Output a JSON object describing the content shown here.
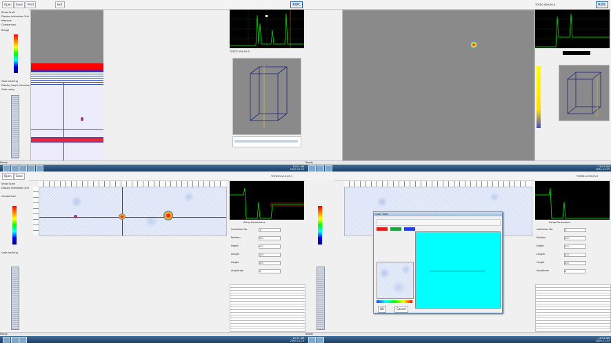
{
  "brand": "KDC",
  "toolbar": {
    "btn1": "Open",
    "btn2": "Save",
    "btn3": "Print",
    "btn4": "Exit"
  },
  "panels": {
    "q1_id": "TOFD7-V09-09-5",
    "q2_id": "TOFD7-V09-09-5",
    "q3_id": "TOFD11-V10-09-1",
    "q4_id": "TOFD13-V09-09-3"
  },
  "left_controls": {
    "cb1": "Show Scale",
    "cb2": "Display Indication Grid",
    "cb3": "Measure",
    "cb4": "Comparison",
    "range_label": "Range",
    "cb5": "Gate tracking",
    "cb6": "Display Graph Comment",
    "cb7": "Gate ramp"
  },
  "right_form": {
    "header": "Setup Parameters",
    "rows": [
      {
        "l": "Indication No.",
        "v": "1"
      },
      {
        "l": "Position",
        "v": "0.0"
      },
      {
        "l": "Depth",
        "v": "0.0"
      },
      {
        "l": "Length",
        "v": "0.0"
      },
      {
        "l": "Height",
        "v": "0.0"
      },
      {
        "l": "Amplitude",
        "v": "0"
      }
    ]
  },
  "dialog": {
    "title": "Color Table",
    "ok": "OK",
    "cancel": "Cancel"
  },
  "statusbar": "Ready",
  "taskbar": {
    "time": "10:31 AM",
    "date": "2009-11-23"
  },
  "colors": {
    "accent": "#1f5fa8",
    "taskbar": "#1f4a78"
  }
}
